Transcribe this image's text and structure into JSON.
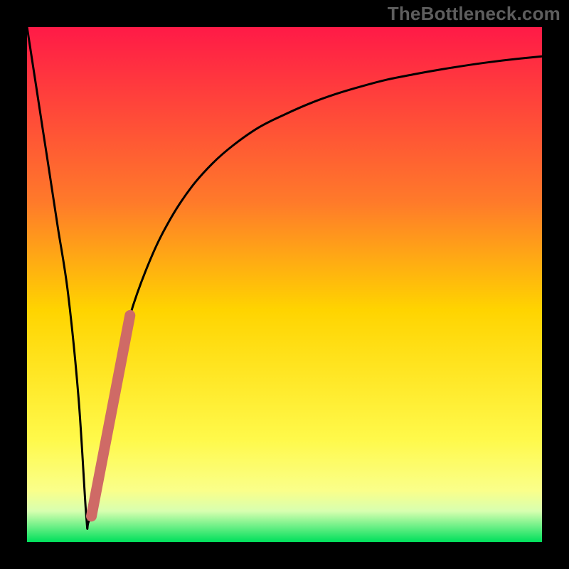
{
  "watermark": "TheBottleneck.com",
  "colors": {
    "frame": "#000000",
    "gradient_top": "#ff1a47",
    "gradient_upper_mid": "#ff7a2a",
    "gradient_mid": "#ffd400",
    "gradient_lower_mid": "#fff94a",
    "gradient_band_yellow": "#faff8a",
    "gradient_band_light": "#d8ffb0",
    "gradient_bottom": "#00e05c",
    "curve": "#000000",
    "overlay_stroke": "#cf6a66"
  },
  "chart_data": {
    "type": "line",
    "title": "",
    "xlabel": "",
    "ylabel": "",
    "xlim": [
      0,
      100
    ],
    "ylim": [
      0,
      100
    ],
    "series": [
      {
        "name": "bottleneck-curve",
        "x": [
          0,
          2,
          4,
          6,
          8,
          10,
          11.5,
          12,
          14,
          16,
          18,
          20,
          24,
          28,
          32,
          36,
          40,
          45,
          50,
          55,
          60,
          65,
          70,
          75,
          80,
          85,
          90,
          95,
          100
        ],
        "y": [
          100,
          87,
          74,
          61,
          48,
          28,
          5,
          4,
          9,
          22,
          35,
          44,
          55,
          63,
          69,
          73.5,
          77,
          80.5,
          83,
          85.2,
          87,
          88.5,
          89.8,
          90.8,
          91.7,
          92.5,
          93.2,
          93.8,
          94.3
        ]
      }
    ],
    "overlay_segment": {
      "name": "highlight-range",
      "x": [
        12.5,
        20
      ],
      "y": [
        5,
        44
      ]
    }
  }
}
